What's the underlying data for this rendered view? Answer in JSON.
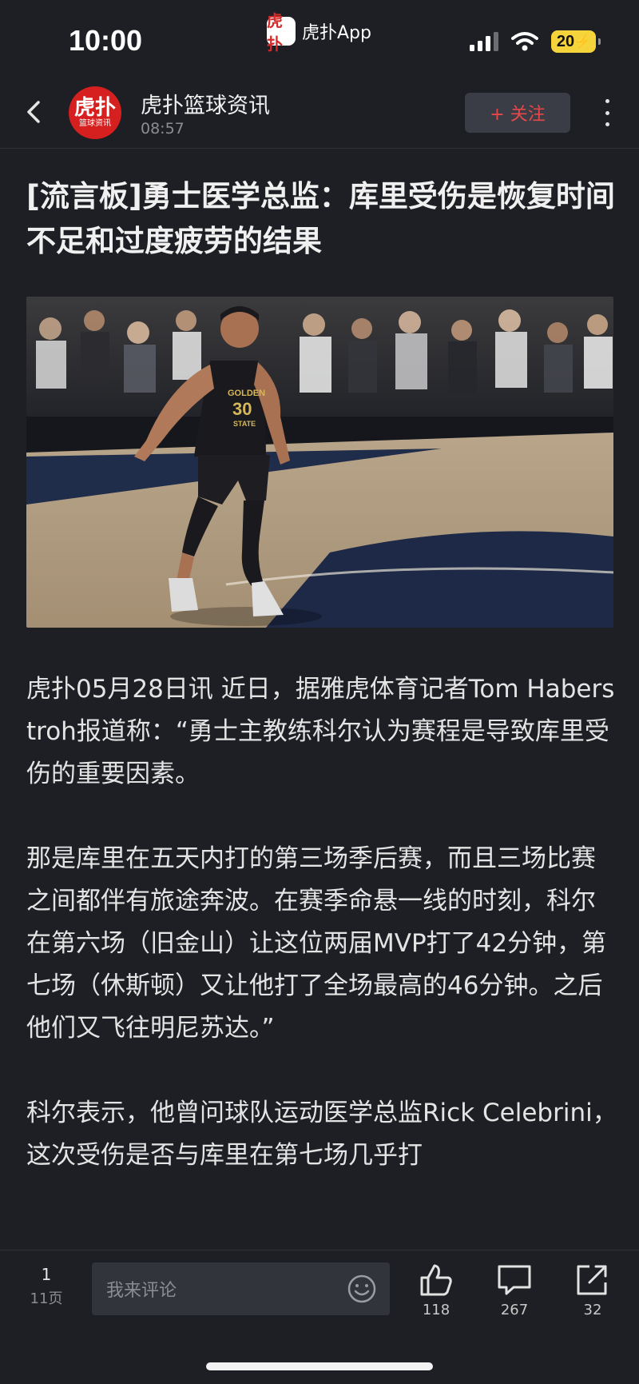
{
  "status_bar": {
    "time": "10:00",
    "app_name": "虎扑App",
    "app_logo_text": "虎扑",
    "battery": "20"
  },
  "header": {
    "account_name": "虎扑篮球资讯",
    "avatar_text": "虎扑",
    "avatar_sub": "篮球资讯",
    "post_time": "08:57",
    "follow_label": "+ 关注"
  },
  "article": {
    "title": "[流言板]勇士医学总监：库里受伤是恢复时间不足和过度疲劳的结果",
    "paragraphs": [
      "虎扑05月28日讯 近日，据雅虎体育记者Tom Haberstroh报道称：“勇士主教练科尔认为赛程是导致库里受伤的重要因素。",
      "那是库里在五天内打的第三场季后赛，而且三场比赛之间都伴有旅途奔波。在赛季命悬一线的时刻，科尔在第六场（旧金山）让这位两届MVP打了42分钟，第七场（休斯顿）又让他打了全场最高的46分钟。之后他们又飞往明尼苏达。”",
      "科尔表示，他曾问球队运动医学总监Rick Celebrini，这次受伤是否与库里在第七场几乎打"
    ],
    "image": {
      "jersey_team_line1": "GOLDEN",
      "jersey_team_line2": "STATE",
      "jersey_number": "30"
    }
  },
  "bottom_bar": {
    "page_current": "1",
    "page_total": "11页",
    "comment_placeholder": "我来评论",
    "likes": "118",
    "comments": "267",
    "shares": "32"
  },
  "icons": {
    "back": "back-chevron-icon",
    "more": "more-vertical-icon",
    "emoji": "emoji-smile-icon",
    "like": "thumbs-up-icon",
    "comment": "comment-bubble-icon",
    "share": "share-arrow-icon"
  },
  "colors": {
    "background": "#1d1f24",
    "accent_red": "#e8474a",
    "brand_red": "#d61f1f"
  }
}
